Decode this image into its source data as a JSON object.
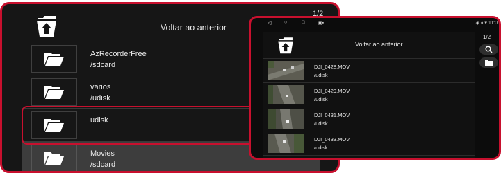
{
  "left": {
    "page_indicator": "1/2",
    "back_label": "Voltar ao anterior",
    "rows": [
      {
        "name": "AzRecorderFree",
        "path": "/sdcard",
        "icon": "folder-icon"
      },
      {
        "name": "varios",
        "path": "/udisk",
        "icon": "folder-icon"
      },
      {
        "name": "udisk",
        "path": "",
        "icon": "folder-icon"
      },
      {
        "name": "Movies",
        "path": "/sdcard",
        "icon": "folder-icon",
        "selected": true
      }
    ]
  },
  "right": {
    "status_time": "11:0",
    "page_indicator": "1/2",
    "back_label": "Voltar ao anterior",
    "files": [
      {
        "name": "DJI_0428.MOV",
        "path": "/udisk"
      },
      {
        "name": "DJI_0429.MOV",
        "path": "/udisk"
      },
      {
        "name": "DJI_0431.MOV",
        "path": "/udisk"
      },
      {
        "name": "DJI_0433.MOV",
        "path": "/udisk"
      }
    ]
  },
  "colors": {
    "highlight": "#c8102e",
    "panel_bg": "#161616",
    "selected_row": "#3d3d3d"
  }
}
